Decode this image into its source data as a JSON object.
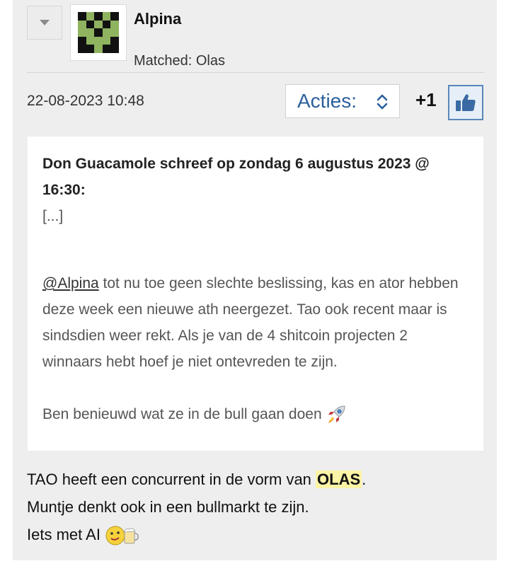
{
  "post": {
    "username": "Alpina",
    "matched": "Matched: Olas",
    "timestamp": "22-08-2023 10:48",
    "actions_label": "Acties:",
    "score": "+1"
  },
  "quote": {
    "header_line1": "Don Guacamole schreef op zondag 6 augustus 2023 @",
    "header_line2": "16:30:",
    "ellipsis": "[...]",
    "mention": "@Alpina",
    "body_text": " tot nu toe geen slechte beslissing, kas en ator hebben deze week een nieuwe ath neergezet. Tao ook recent maar is sindsdien weer rekt. Als je van de 4 shitcoin projecten 2 winnaars hebt hoef je niet ontevreden te zijn.",
    "closing": "Ben benieuwd wat ze in de bull gaan doen"
  },
  "reply": {
    "line1_before": "TAO heeft een concurrent in de vorm van ",
    "line1_highlight": "OLAS",
    "line1_after": ".",
    "line2": "Muntje denkt ook in een bullmarkt te zijn.",
    "line3": "Iets met AI"
  },
  "colors": {
    "accent": "#2b5f9c",
    "highlight": "#fbf3a6",
    "panel": "#eeeeee"
  },
  "icons": [
    "chevron-down-icon",
    "updown-chevron-icon",
    "thumbs-up-icon",
    "rocket-emoji-icon",
    "beer-emoji-icon"
  ]
}
